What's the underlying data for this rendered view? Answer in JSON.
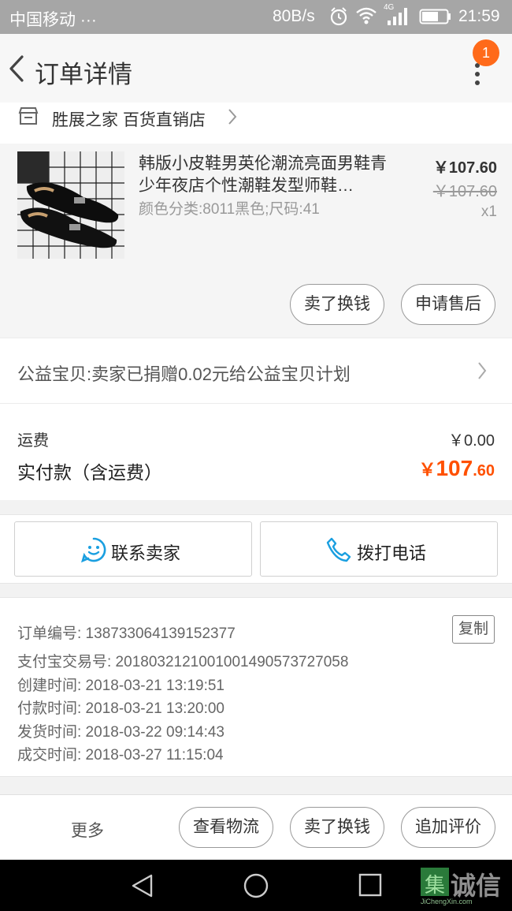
{
  "status_bar": {
    "carrier": "中国移动 ···",
    "network_rate": "80B/s",
    "signal_label": "4G",
    "time": "21:59"
  },
  "header": {
    "title": "订单详情",
    "badge_count": "1"
  },
  "shop": {
    "name": "胜展之家 百货直销店"
  },
  "product": {
    "name": "韩版小皮鞋男英伦潮流亮面男鞋青少年夜店个性潮鞋发型师鞋…",
    "attributes": "颜色分类:8011黑色;尺码:41",
    "price": "￥107.60",
    "original_price": "￥107.60",
    "quantity": "x1",
    "buttons": {
      "resell": "卖了换钱",
      "after_sale": "申请售后"
    }
  },
  "charity": {
    "text": "公益宝贝:卖家已捐赠0.02元给公益宝贝计划"
  },
  "fees": {
    "shipping_label": "运费",
    "shipping_value": "￥0.00",
    "paid_label": "实付款（含运费）",
    "paid_currency": "￥",
    "paid_integer": "107",
    "paid_decimal": ".60"
  },
  "contact": {
    "seller_label": "联系卖家",
    "call_label": "拨打电话"
  },
  "order_info": {
    "copy_label": "复制",
    "order_no": "订单编号: 138733064139152377",
    "alipay_no": "支付宝交易号: 2018032121001001490573727058",
    "created": "创建时间: 2018-03-21 13:19:51",
    "paid": "付款时间: 2018-03-21 13:20:00",
    "shipped": "发货时间: 2018-03-22 09:14:43",
    "completed": "成交时间: 2018-03-27 11:15:04"
  },
  "actions": {
    "more": "更多",
    "logistics": "查看物流",
    "resell": "卖了换钱",
    "add_review": "追加评价"
  },
  "watermark": {
    "mark": "集",
    "text": "诚信",
    "sub": "JiChengXin.com"
  },
  "colors": {
    "accent": "#ff5000",
    "badge": "#ff6a1a",
    "link_blue": "#1a9fe0"
  }
}
